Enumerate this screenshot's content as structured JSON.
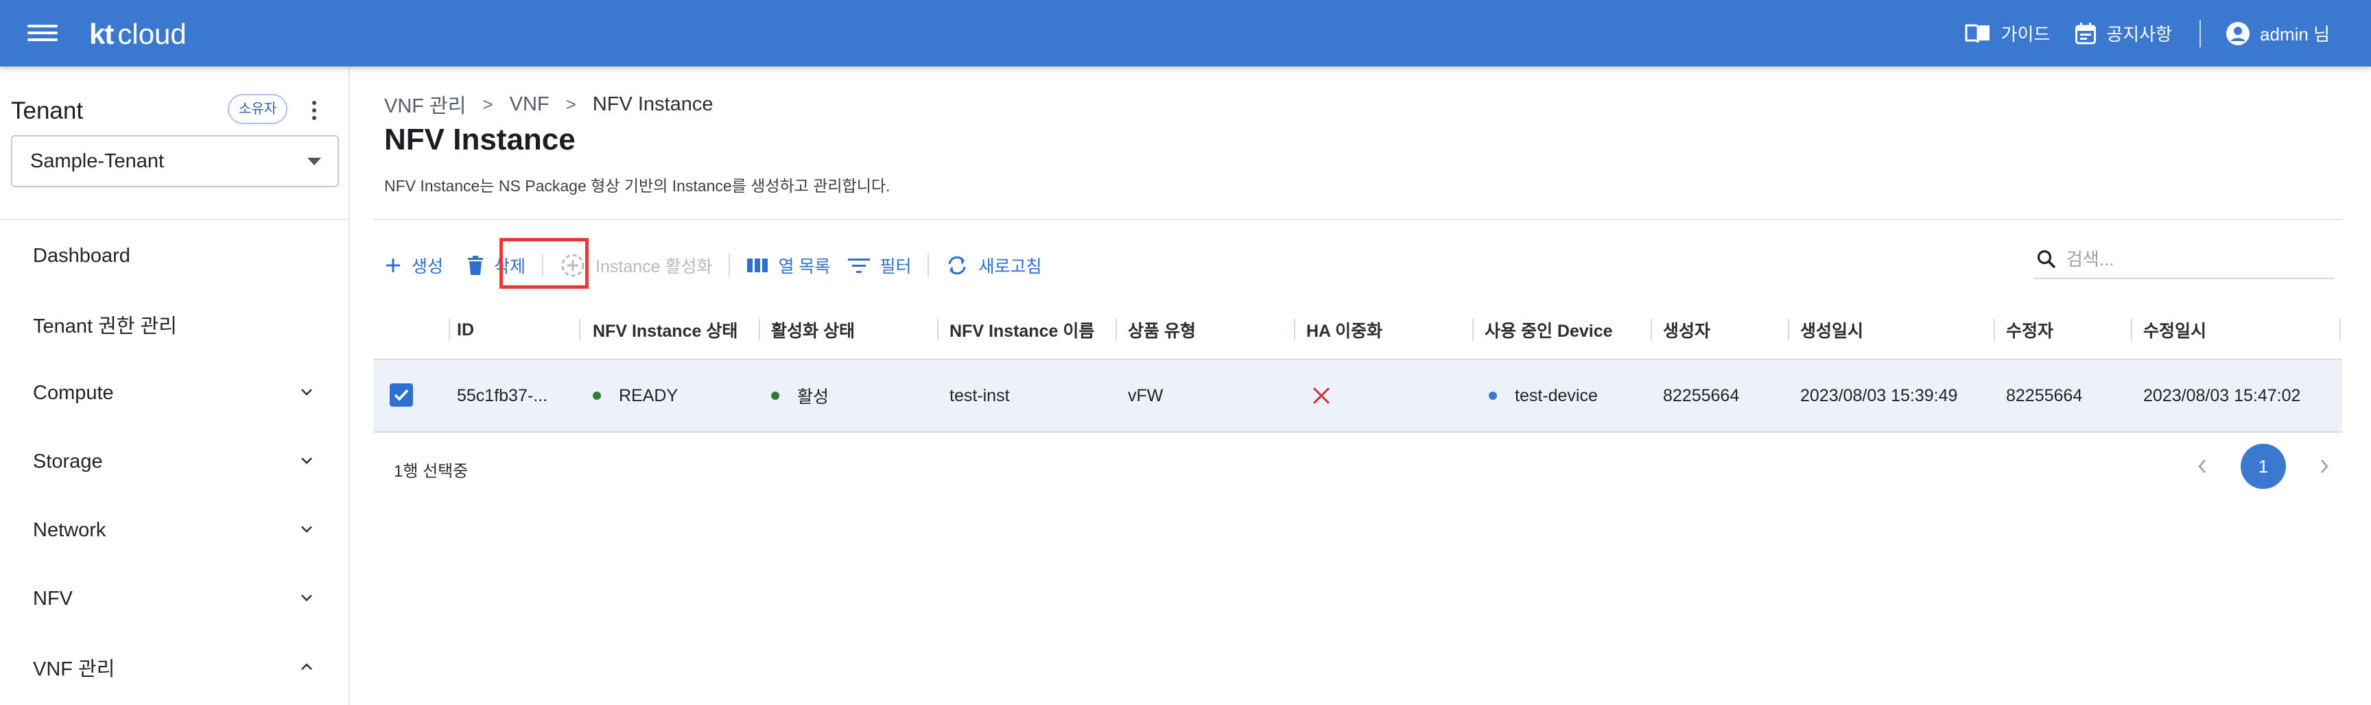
{
  "header": {
    "logo_kt": "kt",
    "logo_cloud": "cloud",
    "guide": "가이드",
    "notice": "공지사항",
    "user": "admin 님"
  },
  "sidebar": {
    "tenant_title": "Tenant",
    "owner_chip": "소유자",
    "tenant_select": "Sample-Tenant",
    "items": [
      {
        "label": "Dashboard",
        "expandable": false
      },
      {
        "label": "Tenant 권한 관리",
        "expandable": false
      },
      {
        "label": "Compute",
        "expandable": true,
        "expanded": false
      },
      {
        "label": "Storage",
        "expandable": true,
        "expanded": false
      },
      {
        "label": "Network",
        "expandable": true,
        "expanded": false
      },
      {
        "label": "NFV",
        "expandable": true,
        "expanded": false
      },
      {
        "label": "VNF 관리",
        "expandable": true,
        "expanded": true
      }
    ]
  },
  "breadcrumb": [
    "VNF 관리",
    "VNF",
    "NFV Instance"
  ],
  "page": {
    "title": "NFV Instance",
    "description": "NFV Instance는 NS Package 형상 기반의 Instance를 생성하고 관리합니다."
  },
  "toolbar": {
    "create": "생성",
    "delete": "삭제",
    "activate": "Instance 활성화",
    "columns": "열 목록",
    "filter": "필터",
    "refresh": "새로고침",
    "search_placeholder": "검색..."
  },
  "table": {
    "columns": [
      "ID",
      "NFV Instance 상태",
      "활성화 상태",
      "NFV Instance 이름",
      "상품 유형",
      "HA 이중화",
      "사용 중인 Device",
      "생성자",
      "생성일시",
      "수정자",
      "수정일시"
    ],
    "rows": [
      {
        "selected": true,
        "id": "55c1fb37-...",
        "status": "READY",
        "activation": "활성",
        "name": "test-inst",
        "product_type": "vFW",
        "ha": false,
        "device": "test-device",
        "creator": "82255664",
        "created_at": "2023/08/03 15:39:49",
        "modifier": "82255664",
        "modified_at": "2023/08/03 15:47:02"
      }
    ]
  },
  "footer": {
    "selection": "1행 선택중",
    "current_page": "1"
  },
  "colors": {
    "brand": "#3b78d0",
    "accent": "#2e6fd0",
    "status_green": "#2e7d32",
    "device_blue": "#3b78d0",
    "ha_no": "#d32f2f",
    "highlight": "#e53935"
  }
}
